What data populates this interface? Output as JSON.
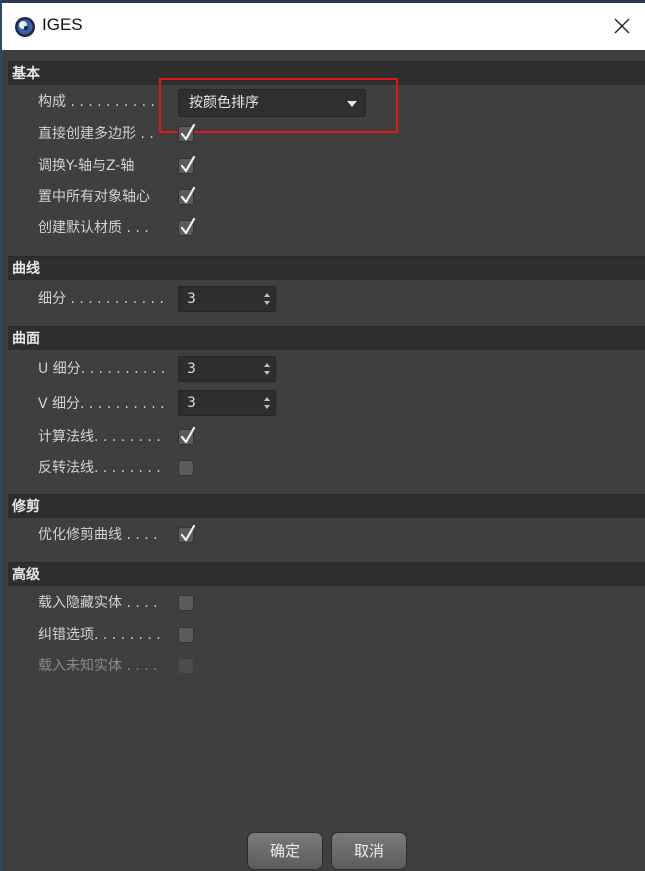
{
  "window": {
    "title": "IGES"
  },
  "sections": {
    "basic": {
      "title": "基本",
      "composition_label": "构成 . . . . . . . . . .",
      "composition_value": "按颜色排序",
      "create_polygon_label": "直接创建多边形 . .",
      "swap_yz_label": "调换Y-轴与Z-轴",
      "center_axes_label": "置中所有对象轴心",
      "default_material_label": "创建默认材质 . . ."
    },
    "curve": {
      "title": "曲线",
      "subdivision_label": "细分 . . . . . . . . . . .",
      "subdivision_value": "3"
    },
    "surface": {
      "title": "曲面",
      "u_subdivision_label": "U 细分. . . . . . . . . .",
      "u_subdivision_value": "3",
      "v_subdivision_label": "V 细分. . . . . . . . . .",
      "v_subdivision_value": "3",
      "calc_normals_label": "计算法线. . . . . . . .",
      "flip_normals_label": "反转法线. . . . . . . ."
    },
    "trim": {
      "title": "修剪",
      "optimize_trim_label": "优化修剪曲线 . . . ."
    },
    "advanced": {
      "title": "高级",
      "load_hidden_label": "载入隐藏实体 . . . .",
      "error_option_label": "纠错选项. . . . . . . .",
      "load_unknown_label": "载入未知实体 . . . ."
    }
  },
  "checks": {
    "create_polygon": true,
    "swap_yz": true,
    "center_axes": true,
    "default_material": true,
    "calc_normals": true,
    "flip_normals": false,
    "optimize_trim": true,
    "load_hidden": false,
    "error_option": false,
    "load_unknown": false
  },
  "buttons": {
    "ok": "确定",
    "cancel": "取消"
  },
  "colors": {
    "highlight": "#e01818",
    "panel": "#3f3f3f",
    "header": "#2e2e2e"
  }
}
